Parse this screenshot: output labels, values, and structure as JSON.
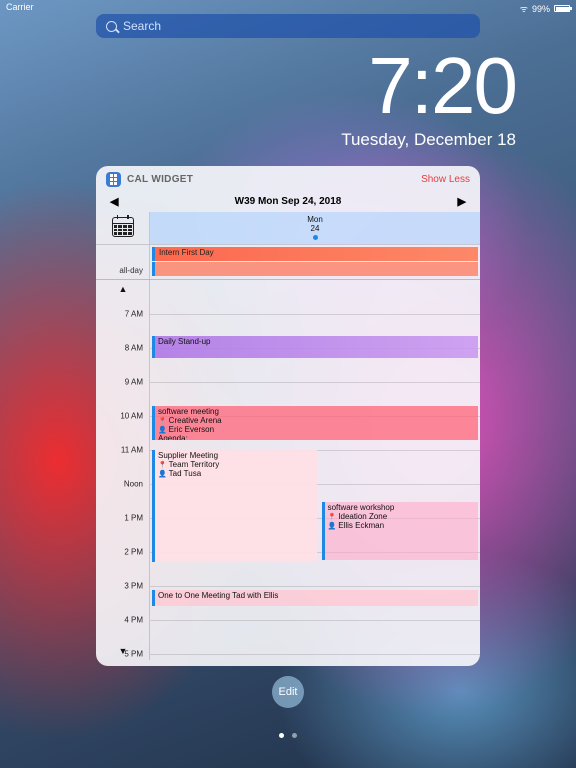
{
  "status": {
    "carrier": "Carrier",
    "battery_pct": "99%"
  },
  "search": {
    "placeholder": "Search"
  },
  "clock": {
    "time": "7:20",
    "date": "Tuesday, December 18"
  },
  "widget": {
    "title": "CAL WIDGET",
    "show_less": "Show Less",
    "nav_title": "W39 Mon Sep 24, 2018",
    "day": {
      "dow": "Mon",
      "num": "24"
    },
    "allday_label": "all-day",
    "allday_events": [
      {
        "title": "Intern First Day"
      }
    ],
    "hours": [
      "7 AM",
      "8 AM",
      "9 AM",
      "10 AM",
      "11 AM",
      "Noon",
      "1 PM",
      "2 PM",
      "3 PM",
      "4 PM",
      "5 PM"
    ],
    "events": {
      "standup": {
        "title": "Daily Stand-up"
      },
      "sw_meeting": {
        "title": "software meeting",
        "location": "Creative Arena",
        "person": "Eric Everson",
        "extra": "Agenda:"
      },
      "supplier": {
        "title": "Supplier Meeting",
        "location": "Team Territory",
        "person": "Tad Tusa"
      },
      "workshop": {
        "title": "software workshop",
        "location": "Ideation Zone",
        "person": "Ellis Eckman"
      },
      "one2one": {
        "title": "One to One Meeting Tad with Ellis"
      }
    }
  },
  "edit": "Edit"
}
